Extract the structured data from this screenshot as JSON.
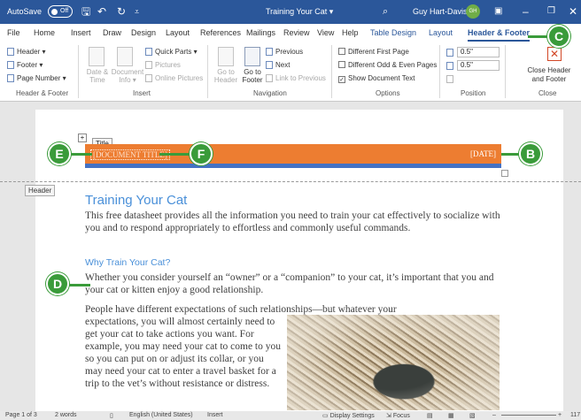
{
  "titlebar": {
    "autosave_label": "AutoSave",
    "autosave_state": "Off",
    "document_title": "Training Your Cat ▾",
    "user_name": "Guy Hart-Davis",
    "user_initials": "GH"
  },
  "tabs": [
    "File",
    "Home",
    "Insert",
    "Draw",
    "Design",
    "Layout",
    "References",
    "Mailings",
    "Review",
    "View",
    "Help",
    "Table Design",
    "Layout",
    "Header & Footer"
  ],
  "ribbon": {
    "hf_group": {
      "header": "Header ▾",
      "footer": "Footer ▾",
      "page_number": "Page Number ▾",
      "label": "Header & Footer"
    },
    "insert_group": {
      "date_time": "Date & Time",
      "doc_info": "Document Info ▾",
      "quick_parts": "Quick Parts ▾",
      "pictures": "Pictures",
      "online_pictures": "Online Pictures",
      "label": "Insert"
    },
    "nav_group": {
      "goto_header": "Go to Header",
      "goto_footer": "Go to Footer",
      "previous": "Previous",
      "next": "Next",
      "link_previous": "Link to Previous",
      "label": "Navigation"
    },
    "options_group": {
      "diff_first": "Different First Page",
      "diff_odd_even": "Different Odd & Even Pages",
      "show_doc_text": "Show Document Text",
      "label": "Options"
    },
    "position_group": {
      "header_pos": "0.5\"",
      "footer_pos": "0.5\"",
      "label": "Position"
    },
    "close_group": {
      "close_button": "Close Header and Footer",
      "label": "Close"
    }
  },
  "document": {
    "title_tag": "Title",
    "title_placeholder": "[DOCUMENT TITLE]",
    "date_placeholder": "[DATE]",
    "header_tag": "Header",
    "heading1": "Training Your Cat",
    "para1": "This free datasheet provides all the information you need to train your cat effectively to socialize with you and to respond appropriately to effortless and commonly useful commands.",
    "heading2": "Why Train Your Cat?",
    "para2": "Whether you consider yourself an “owner” or a “companion” to your cat, it’s important that you and your cat or kitten enjoy a good relationship.",
    "para3_lead": "People have different expectations of such relationships—but whatever your",
    "para3_wrap": "expectations, you will almost certainly need to get your cat to take actions you want. For example, you may need your cat to come to you so you can put on or adjust its collar, or you may need your cat to enter a travel basket for a trip to the vet’s without resistance or distress."
  },
  "callouts": {
    "b": "B",
    "c": "C",
    "d": "D",
    "e": "E",
    "f": "F"
  },
  "statusbar": {
    "page": "Page 1 of 3",
    "words": "2 words",
    "language": "English (United States)",
    "mode": "Insert",
    "display": "Display Settings",
    "focus": "Focus",
    "zoom": "117"
  },
  "colors": {
    "accent": "#2b579a",
    "header_bar": "#ed7d31",
    "rule": "#4472c4",
    "callout": "#3a9b3a",
    "heading": "#4a90d9"
  }
}
